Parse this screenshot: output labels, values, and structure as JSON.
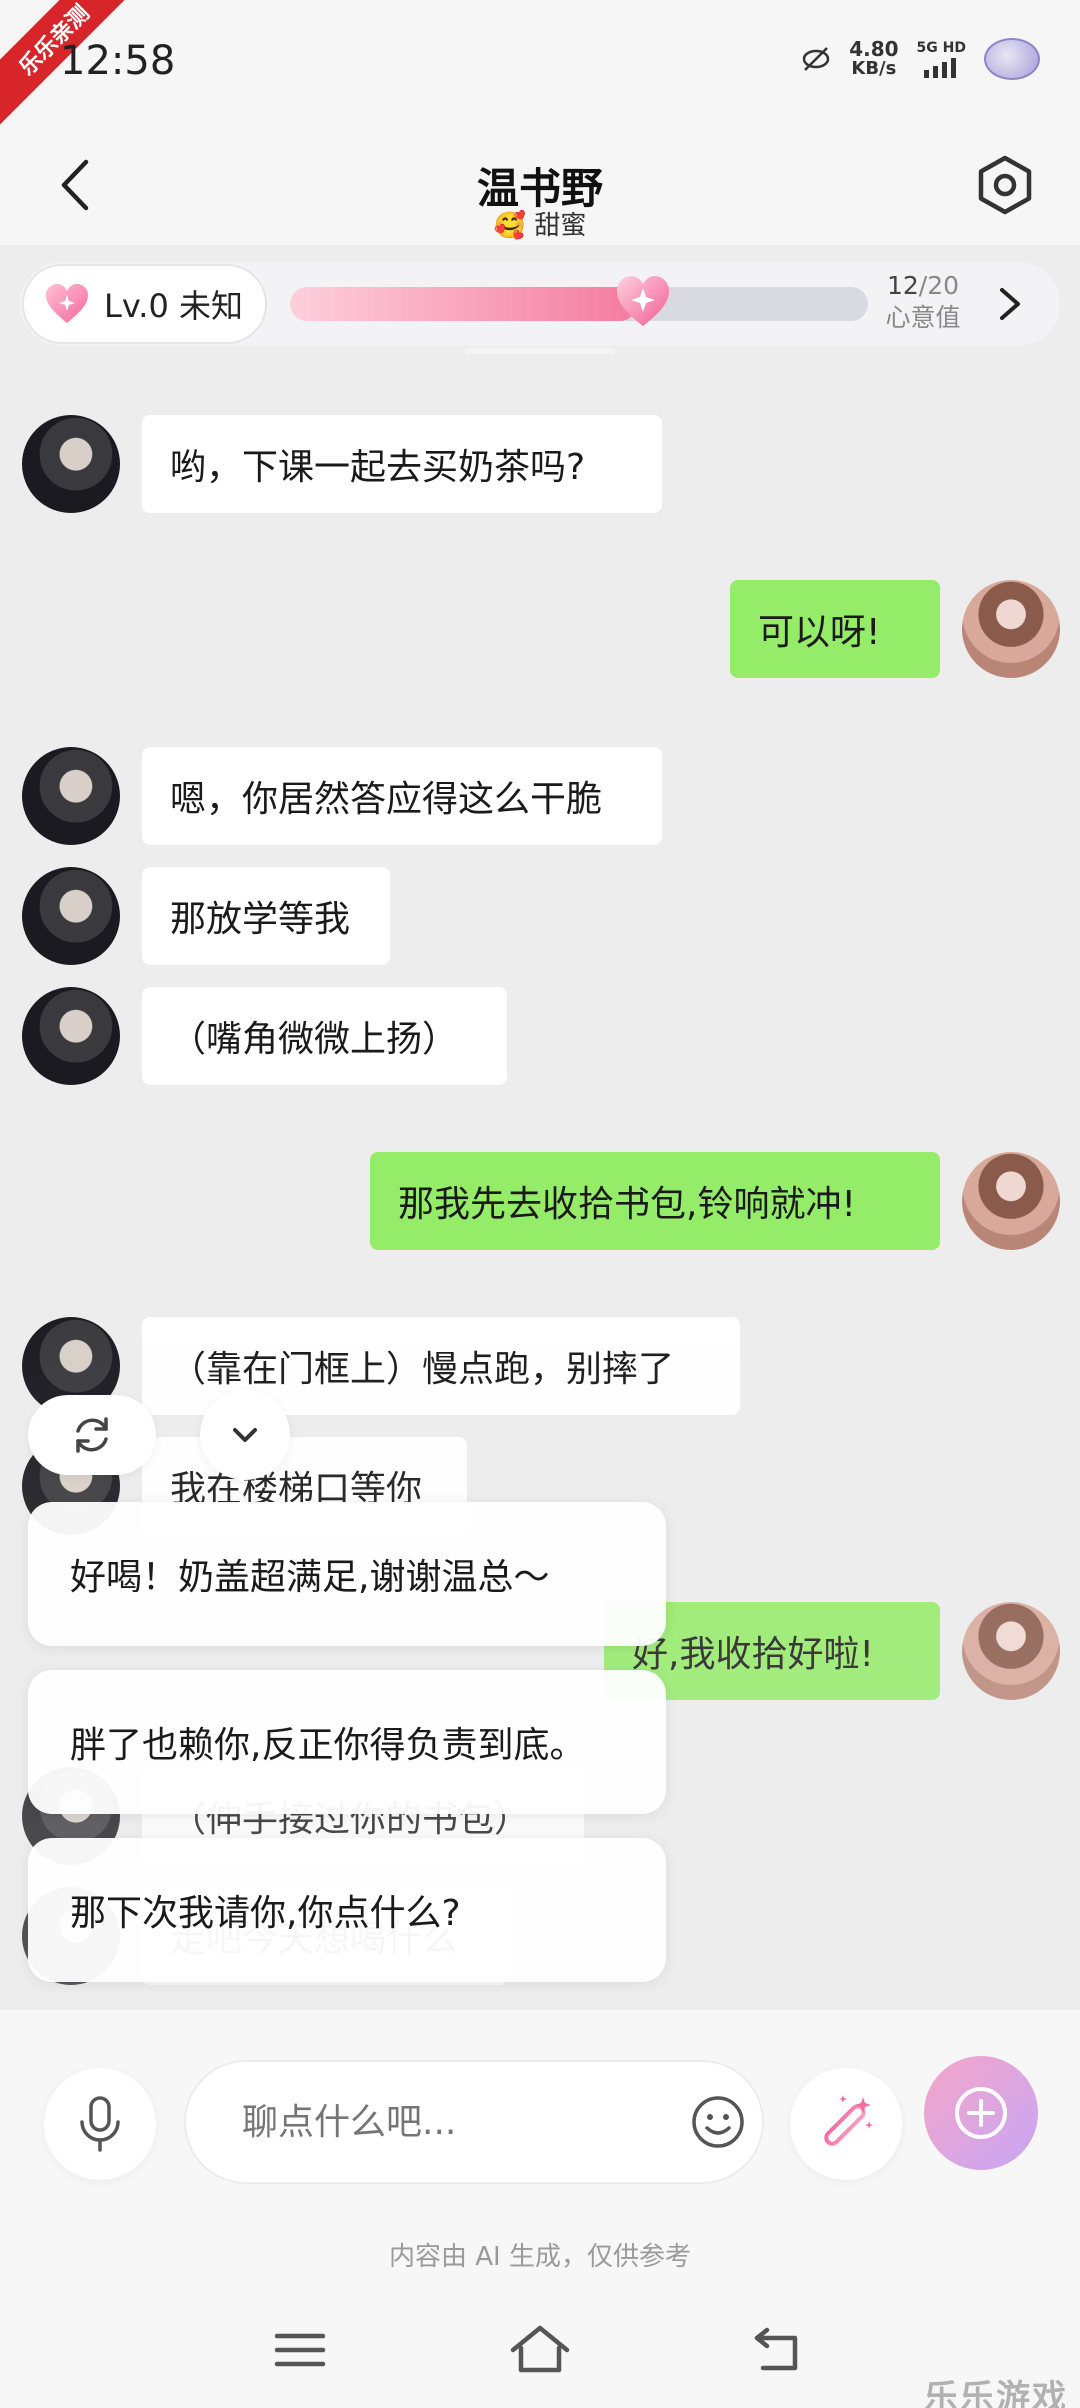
{
  "status_bar": {
    "time": "12:58",
    "ribbon": "乐乐亲测",
    "net_speed_value": "4.80",
    "net_speed_unit": "KB/s",
    "signal_label": "5G HD"
  },
  "header": {
    "title": "温书野",
    "subtitle_emoji": "🥰",
    "subtitle": "甜蜜"
  },
  "level": {
    "label": "Lv.0  未知",
    "progress_current": "12",
    "progress_total": "/20",
    "progress_fraction": 0.6,
    "caption": "心意值"
  },
  "messages": [
    {
      "role": "bot",
      "text": "哟，下课一起去买奶茶吗?"
    },
    {
      "role": "user",
      "text": "可以呀!"
    },
    {
      "role": "bot",
      "text": "嗯，你居然答应得这么干脆"
    },
    {
      "role": "bot",
      "text": "那放学等我"
    },
    {
      "role": "bot",
      "text": "（嘴角微微上扬）"
    },
    {
      "role": "user",
      "text": "那我先去收拾书包,铃响就冲!"
    },
    {
      "role": "bot",
      "text": "（靠在门框上）慢点跑，别摔了"
    },
    {
      "role": "bot",
      "text": "我在楼梯口等你"
    },
    {
      "role": "user",
      "text": "好,我收拾好啦!"
    },
    {
      "role": "bot",
      "text": "（伸手接过你的书包）"
    },
    {
      "role": "bot",
      "text": "走吧今天想喝什么"
    }
  ],
  "suggestions": [
    "好喝！奶盖超满足,谢谢温总～",
    "胖了也赖你,反正你得负责到底。",
    "那下次我请你,你点什么?"
  ],
  "input": {
    "placeholder": "聊点什么吧..."
  },
  "disclaimer": "内容由 AI 生成，仅供参考",
  "watermark": "乐乐游戏",
  "colors": {
    "user_bubble": "#95ec69",
    "bot_bubble": "#ffffff",
    "accent_pink": "#f57ba0",
    "background": "#ededed"
  },
  "icons": {
    "back": "chevron-left-icon",
    "settings": "hexagon-settings-icon",
    "heart": "heart-icon",
    "refresh": "refresh-icon",
    "collapse": "chevron-down-icon",
    "mic": "microphone-icon",
    "emoji": "smiley-icon",
    "magic": "magic-wand-icon",
    "send": "plus-circle-icon"
  }
}
